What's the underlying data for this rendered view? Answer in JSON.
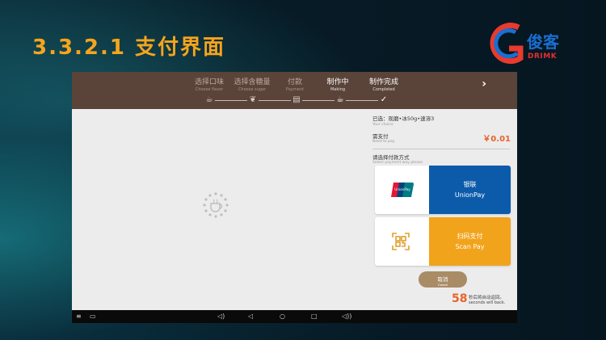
{
  "slide": {
    "title": "3.3.2.1 支付界面"
  },
  "logo": {
    "cn": "俊客",
    "en": "DRIMK"
  },
  "stepper": {
    "steps": [
      {
        "cn": "选择口味",
        "en": "Choose flavor",
        "icon": "cup-icon"
      },
      {
        "cn": "选择含糖量",
        "en": "Choose sugar",
        "icon": "leaf-icon"
      },
      {
        "cn": "付款",
        "en": "Payment",
        "icon": "receipt-icon"
      },
      {
        "cn": "制作中",
        "en": "Making",
        "icon": "coffee-icon"
      },
      {
        "cn": "制作完成",
        "en": "Completed",
        "icon": "check-icon"
      }
    ],
    "active_index": 4
  },
  "order": {
    "selected": "已选：现磨•冰50g•速溶3",
    "selected_en": "Your choice",
    "need_pay": "需支付",
    "need_pay_en": "Need to pay",
    "price": "￥0.01",
    "method_label": "请选择付款方式",
    "method_label_en": "Select payment way please"
  },
  "payments": [
    {
      "cn": "银联",
      "en": "UnionPay",
      "color": "#0c5bab"
    },
    {
      "cn": "扫码支付",
      "en": "Scan Pay",
      "color": "#f2a31c"
    }
  ],
  "cancel": {
    "cn": "取消",
    "en": "Cancel"
  },
  "countdown": {
    "seconds": "58",
    "cn": "秒后将自动返回。",
    "en": "seconds will back."
  },
  "union_logo_text": "UnionPay 银联"
}
